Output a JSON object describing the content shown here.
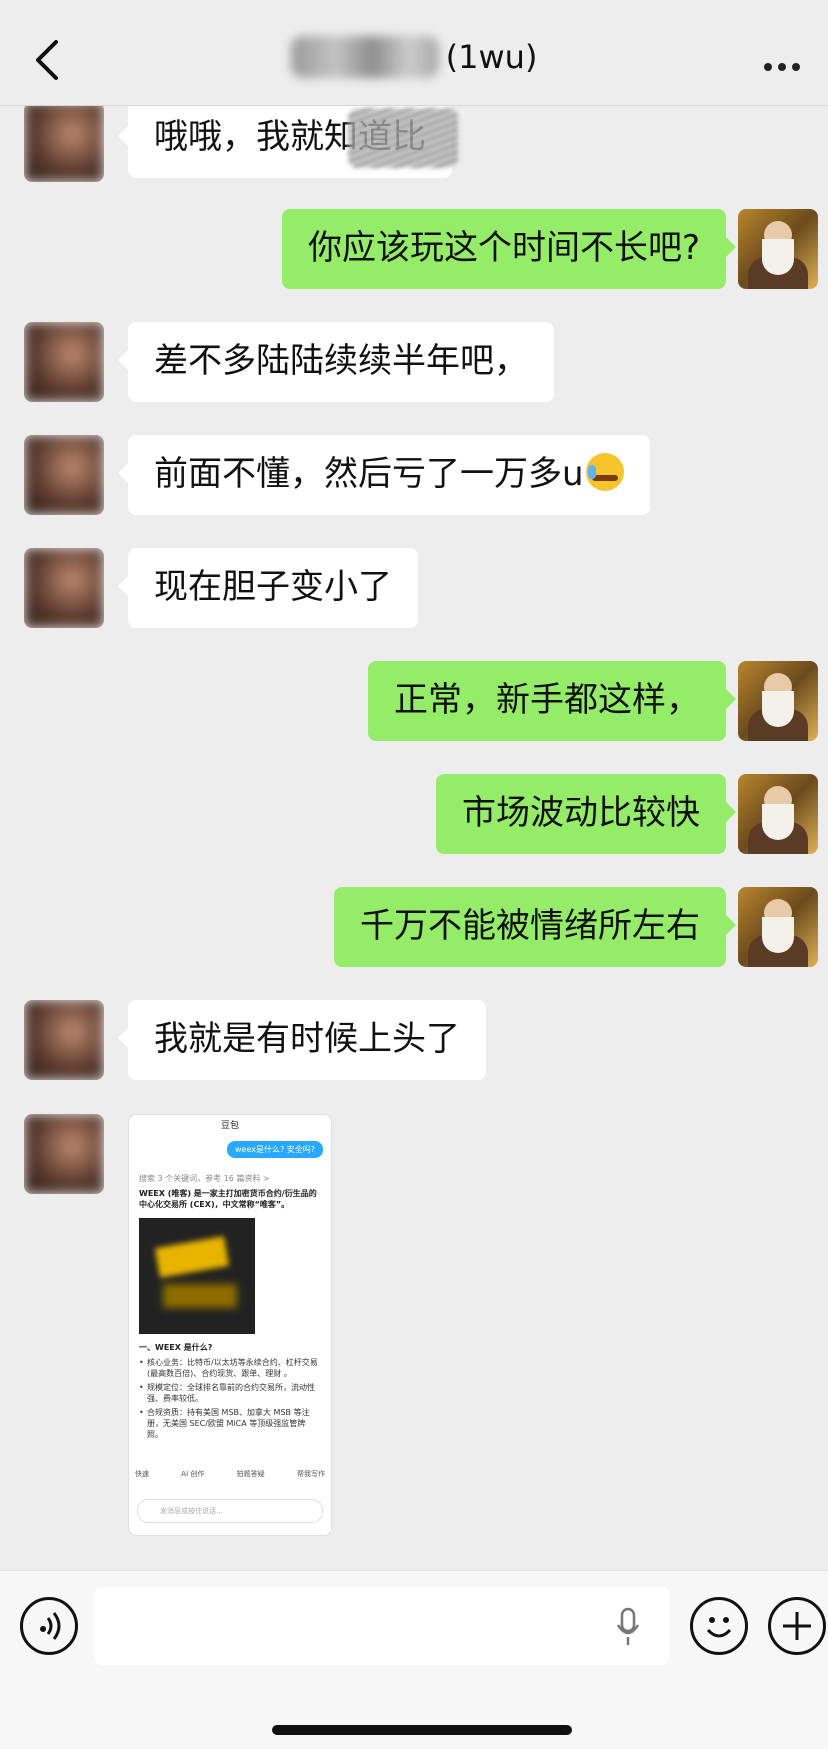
{
  "header": {
    "title_suffix": "(1wu)",
    "back_icon": "chevron-left-icon",
    "more_icon": "more-dots-icon"
  },
  "messages": [
    {
      "side": "left",
      "text": "哦哦，我就知道比"
    },
    {
      "side": "right",
      "text": "你应该玩这个时间不长吧?"
    },
    {
      "side": "left",
      "text": "差不多陆陆续续半年吧，"
    },
    {
      "side": "left",
      "text": "前面不懂，然后亏了一万多u",
      "emoji": "crying-laughing-emoji"
    },
    {
      "side": "left",
      "text": "现在胆子变小了"
    },
    {
      "side": "right",
      "text": "正常，新手都这样，"
    },
    {
      "side": "right",
      "text": "市场波动比较快"
    },
    {
      "side": "right",
      "text": "千万不能被情绪所左右"
    },
    {
      "side": "left",
      "text": "我就是有时候上头了"
    }
  ],
  "image_message": {
    "app_title": "豆包",
    "question": "weex是什么? 安全吗?",
    "meta": "搜索 3 个关键词，参考 16 篇资料 >",
    "lead": "WEEX (唯客) 是一家主打加密货币合约/衍生品的中心化交易所 (CEX)，中文常称“唯客”。",
    "heading": "一、WEEX 是什么?",
    "bullets": [
      "核心业务：比特币/以太坊等永续合约、杠杆交易 (最高数百倍)、合约现货、跟单、理财 。",
      "规模定位：全球排名靠前的合约交易所，流动性强、费率较低。",
      "合规资质：持有美国 MSB、加拿大 MSB 等注册，无美国 SEC/欧盟 MiCA 等顶级强监管牌照。"
    ],
    "tools": [
      "快速",
      "AI 创作",
      "拍题答疑",
      "帮我写作"
    ],
    "input_placeholder": "发消息或按住说话..."
  },
  "input_bar": {
    "voice_icon": "voice-icon",
    "mic_icon": "microphone-icon",
    "emoji_icon": "smiley-icon",
    "plus_icon": "plus-icon"
  }
}
